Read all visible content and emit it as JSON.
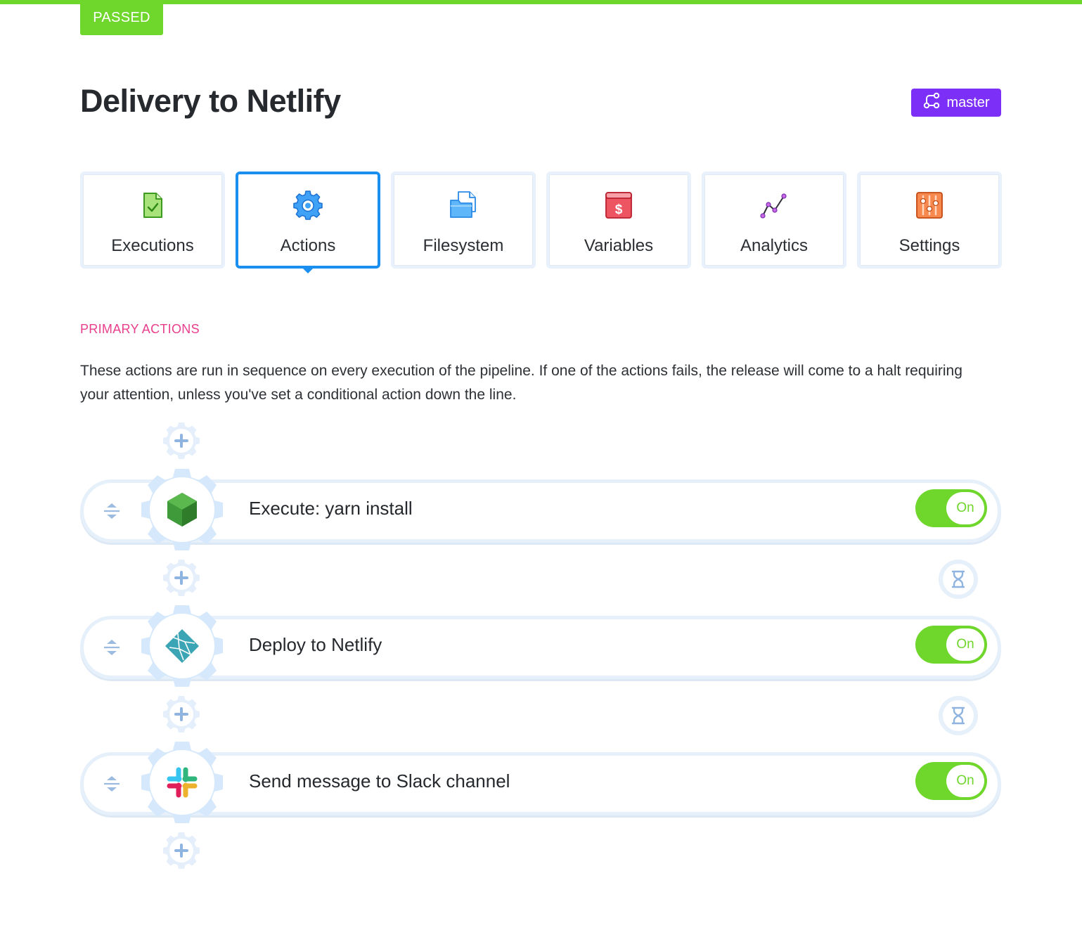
{
  "status": {
    "label": "PASSED",
    "color": "#6fd62b"
  },
  "page": {
    "title": "Delivery to Netlify"
  },
  "branch": {
    "label": "master",
    "color": "#7b2ff7"
  },
  "tabs": [
    {
      "label": "Executions",
      "icon": "document-check-icon",
      "active": false
    },
    {
      "label": "Actions",
      "icon": "gear-icon",
      "active": true
    },
    {
      "label": "Filesystem",
      "icon": "folder-icon",
      "active": false
    },
    {
      "label": "Variables",
      "icon": "dollar-box-icon",
      "active": false
    },
    {
      "label": "Analytics",
      "icon": "line-chart-icon",
      "active": false
    },
    {
      "label": "Settings",
      "icon": "sliders-icon",
      "active": false
    }
  ],
  "section": {
    "heading": "PRIMARY ACTIONS",
    "heading_color": "#e83e8c",
    "description": "These actions are run in sequence on every execution of the pipeline. If one of the actions fails, the release will come to a halt requiring your attention, unless you've set a conditional action down the line."
  },
  "actions": [
    {
      "title": "Execute: yarn install",
      "icon": "nodejs-icon",
      "toggle_label": "On",
      "enabled": true
    },
    {
      "title": "Deploy to Netlify",
      "icon": "netlify-icon",
      "toggle_label": "On",
      "enabled": true
    },
    {
      "title": "Send message to Slack channel",
      "icon": "slack-icon",
      "toggle_label": "On",
      "enabled": true
    }
  ],
  "colors": {
    "accent": "#1a8ff0",
    "toggle_on": "#6fd62b",
    "gear_light": "#d6e8fb",
    "gear_plus": "#8fb4e0"
  }
}
